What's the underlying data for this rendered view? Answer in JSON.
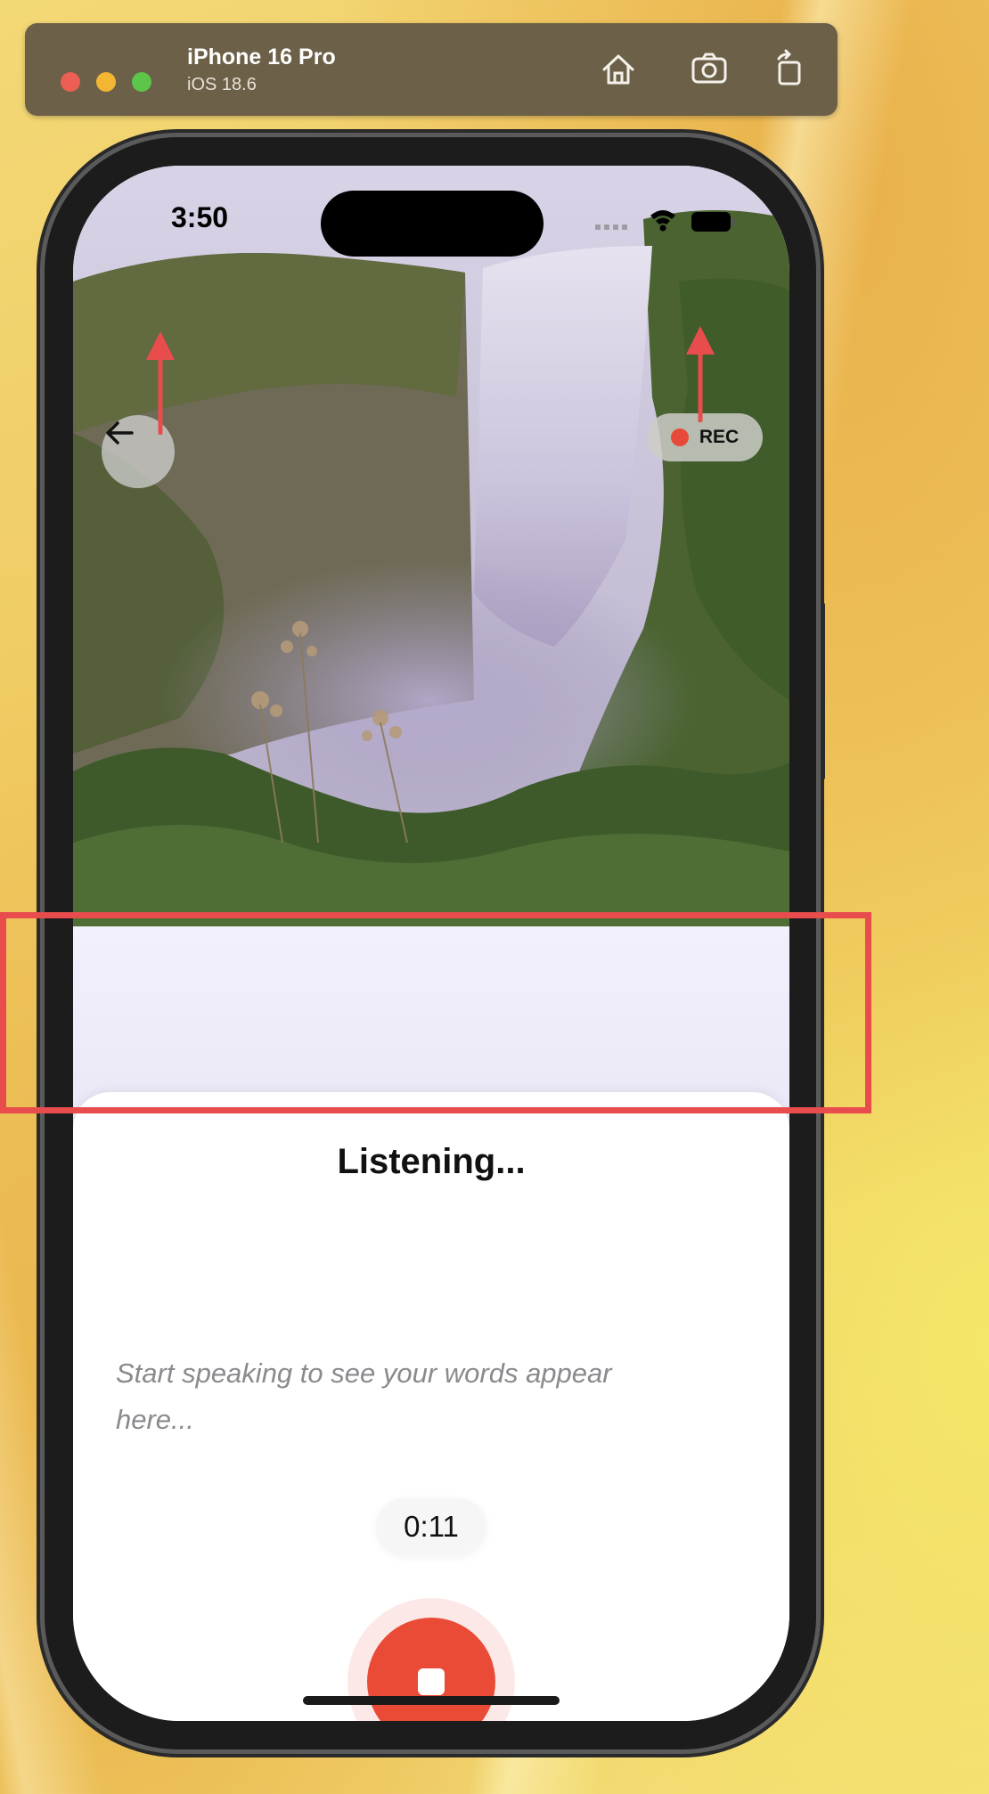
{
  "simulator": {
    "device_name": "iPhone 16 Pro",
    "os_version": "iOS 18.6",
    "buttons": [
      "home-icon",
      "screenshot-icon",
      "rotate-icon"
    ]
  },
  "status_bar": {
    "time": "3:50"
  },
  "top_controls": {
    "back_icon": "arrow-left-icon",
    "rec_label": "REC",
    "rec_color": "#e84a3a"
  },
  "sheet": {
    "title": "Listening...",
    "placeholder": "Start speaking to see your words appear here...",
    "timer": "0:11",
    "stop_icon": "stop-icon",
    "stop_color": "#e94b37"
  },
  "annotations": {
    "color": "#e84c4c",
    "items": [
      "highlight-box",
      "arrow-to-back-button",
      "arrow-to-rec-pill"
    ]
  }
}
